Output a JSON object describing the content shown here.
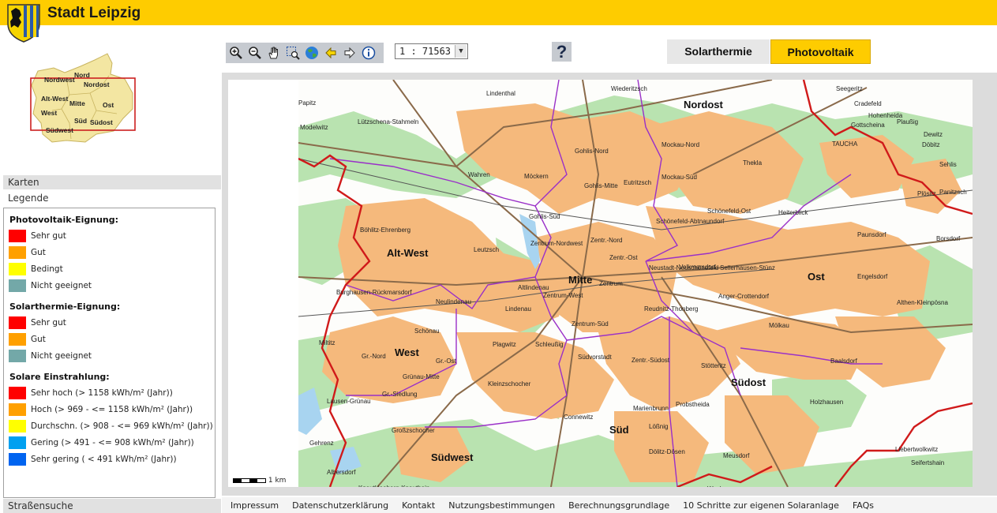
{
  "header": {
    "title": "Stadt Leipzig"
  },
  "overview": {
    "labels": [
      "Nord",
      "Nordwest",
      "Nordost",
      "Alt-West",
      "Mitte",
      "Ost",
      "West",
      "Süd",
      "Südost",
      "Südwest"
    ]
  },
  "panels": {
    "karten": "Karten",
    "legende": "Legende",
    "strassensuche": "Straßensuche"
  },
  "legend": {
    "sections": [
      {
        "heading": "Photovoltaik-Eignung:",
        "items": [
          {
            "color": "#ff0000",
            "label": "Sehr gut"
          },
          {
            "color": "#ffa000",
            "label": "Gut"
          },
          {
            "color": "#ffff00",
            "label": "Bedingt"
          },
          {
            "color": "#73a8a8",
            "label": "Nicht geeignet"
          }
        ]
      },
      {
        "heading": "Solarthermie-Eignung:",
        "items": [
          {
            "color": "#ff0000",
            "label": "Sehr gut"
          },
          {
            "color": "#ffa000",
            "label": "Gut"
          },
          {
            "color": "#73a8a8",
            "label": "Nicht geeignet"
          }
        ]
      },
      {
        "heading": "Solare Einstrahlung:",
        "items": [
          {
            "color": "#ff0000",
            "label": "Sehr hoch (> 1158 kWh/m² (Jahr))"
          },
          {
            "color": "#ffa000",
            "label": "Hoch (> 969 - <= 1158 kWh/m² (Jahr))"
          },
          {
            "color": "#ffff00",
            "label": "Durchschn. (> 908 - <= 969 kWh/m² (Jahr))"
          },
          {
            "color": "#00a0f0",
            "label": "Gering (> 491 - <= 908 kWh/m² (Jahr))"
          },
          {
            "color": "#0064f0",
            "label": "Sehr gering ( < 491 kWh/m² (Jahr))"
          }
        ]
      }
    ]
  },
  "toolbar": {
    "tools": [
      "zoom-in-icon",
      "zoom-out-icon",
      "pan-hand-icon",
      "zoom-box-icon",
      "globe-icon",
      "back-arrow-icon",
      "forward-arrow-icon",
      "info-icon"
    ],
    "scale_value": "1 : 71563",
    "help_label": "?"
  },
  "modes": {
    "solarthermie": "Solarthermie",
    "photovoltaik": "Photovoltaik",
    "active": "Photovoltaik"
  },
  "map": {
    "districts": [
      "Nordost",
      "Alt-West",
      "Mitte",
      "Ost",
      "West",
      "Südost",
      "Süd",
      "Südwest"
    ],
    "places": [
      "Lindenthal",
      "Wiederitzsch",
      "Seegeritz",
      "Papitz",
      "Cradefeld",
      "Lützschena-Stahmeln",
      "Hohenheida",
      "Modelwitz",
      "Gottscheina",
      "Plaußig",
      "TAUCHA",
      "Dewitz",
      "Döbitz",
      "Gohlis-Nord",
      "Mockau-Nord",
      "Thekla",
      "Sehlis",
      "Wahren",
      "Möckern",
      "Gohlis-Mitte",
      "Eutritzsch",
      "Mockau-Süd",
      "Plösitz",
      "Panitzsch",
      "Gohlis-Süd",
      "Schönefeld-Ost",
      "Heiterblick",
      "Schönefeld-Abtnaundorf",
      "Böhlitz-Ehrenberg",
      "Zentrum-Nordwest",
      "Zentr.-Nord",
      "Paunsdorf",
      "Borsdorf",
      "Leutzsch",
      "Zentr.-Ost",
      "Volkmarsdorf",
      "Sellerhausen-Stünz",
      "Neustadt-Neuschönefeld",
      "Engelsdorf",
      "Burghausen-Rückmarsdorf",
      "Altlindenau",
      "Zentrum",
      "Anger-Crottendorf",
      "Neulindenau",
      "Zentrum-West",
      "Lindenau",
      "Althen-Kleinpösna",
      "Reudnitz-Thonberg",
      "Schönau",
      "Zentrum-Süd",
      "Mölkau",
      "Miltitz",
      "Plagwitz",
      "Schleußig",
      "Gr.-Nord",
      "Gr.-Ost",
      "Südvorstadt",
      "Zentr.-Südost",
      "Baalsdorf",
      "Grünau-Mitte",
      "Stötteritz",
      "Lausen-Grünau",
      "Gr.-Siedlung",
      "Kleinzschocher",
      "Probstheida",
      "Holzhausen",
      "Connewitz",
      "Marienbrunn",
      "Großzschocher",
      "Lößnig",
      "Liebertwolkwitz",
      "Gehrenz",
      "Dölitz-Dösen",
      "Seifertshain",
      "Albersdorf",
      "Meusdorf",
      "Knautkleeberg-Knauthain",
      "Wachau"
    ],
    "scale_label": "1 km"
  },
  "footer": {
    "links": [
      "Impressum",
      "Datenschutzerklärung",
      "Kontakt",
      "Nutzungsbestimmungen",
      "Berechnungsgrundlage",
      "10 Schritte zur eigenen Solaranlage",
      "FAQs"
    ]
  }
}
